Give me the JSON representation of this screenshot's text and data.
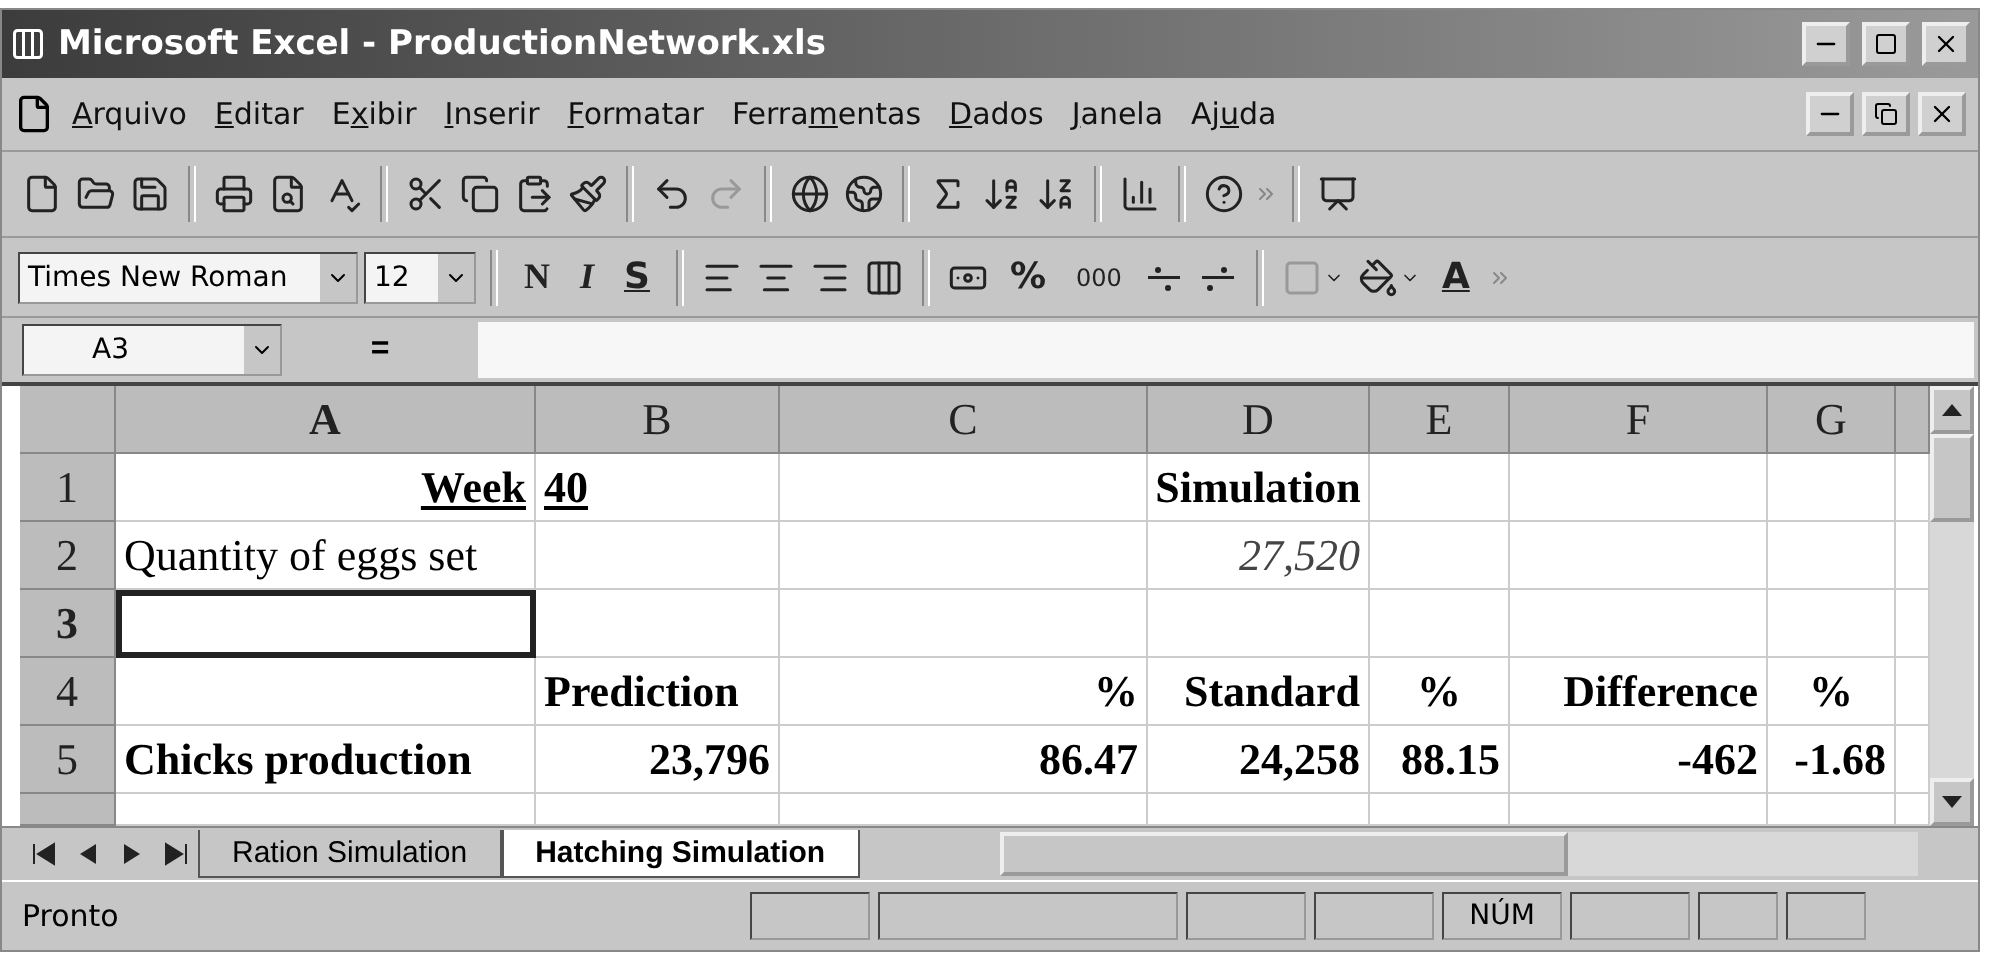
{
  "window": {
    "title": "Microsoft Excel - ProductionNetwork.xls"
  },
  "menu": [
    {
      "key": "A",
      "after": "rquivo"
    },
    {
      "key": "E",
      "after": "ditar"
    },
    {
      "before": "E",
      "key": "x",
      "after": "ibir"
    },
    {
      "key": "I",
      "after": "nserir"
    },
    {
      "key": "F",
      "after": "ormatar"
    },
    {
      "before": "Ferra",
      "key": "m",
      "after": "entas"
    },
    {
      "key": "D",
      "after": "ados"
    },
    {
      "key": "J",
      "after": "anela"
    },
    {
      "before": "Aj",
      "key": "u",
      "after": "da"
    }
  ],
  "standard_toolbar": {
    "redo_disabled": true
  },
  "format_toolbar": {
    "font": "Times New Roman",
    "size": "12",
    "bold": "N",
    "italic": "I",
    "underline": "S",
    "percent": "%",
    "thousands": "000",
    "font_color": "A"
  },
  "formula_bar": {
    "name_box": "A3",
    "equals": "="
  },
  "columns": [
    {
      "label": "A",
      "selected": true
    },
    {
      "label": "B",
      "selected": false
    },
    {
      "label": "C",
      "selected": false
    },
    {
      "label": "D",
      "selected": false
    },
    {
      "label": "E",
      "selected": false
    },
    {
      "label": "F",
      "selected": false
    },
    {
      "label": "G",
      "selected": false
    }
  ],
  "rows": [
    {
      "number": "1",
      "selected": false,
      "cells": [
        {
          "text": "Week",
          "right": true,
          "bold": true,
          "underline": true
        },
        {
          "text": "40",
          "bold": true,
          "underline": true
        },
        null,
        {
          "text": "Simulation",
          "center": true,
          "bold": true
        },
        null,
        null,
        null
      ]
    },
    {
      "number": "2",
      "selected": false,
      "cells": [
        {
          "text": "Quantity of eggs set"
        },
        null,
        null,
        {
          "text": "27,520",
          "right": true,
          "italic": true
        },
        null,
        null,
        null
      ]
    },
    {
      "number": "3",
      "selected": true,
      "cells": [
        null,
        null,
        null,
        null,
        null,
        null,
        null
      ]
    },
    {
      "number": "4",
      "selected": false,
      "cells": [
        null,
        {
          "text": "Prediction",
          "bold": true
        },
        {
          "text": "%",
          "right": true,
          "bold": true
        },
        {
          "text": "Standard",
          "right": true,
          "bold": true
        },
        {
          "text": "%",
          "center": true,
          "bold": true
        },
        {
          "text": "Difference",
          "right": true,
          "bold": true
        },
        {
          "text": "%",
          "center": true,
          "bold": true
        }
      ]
    },
    {
      "number": "5",
      "selected": false,
      "cells": [
        {
          "text": "Chicks production",
          "bold": true
        },
        {
          "text": "23,796",
          "right": true,
          "bold": true
        },
        {
          "text": "86.47",
          "right": true,
          "bold": true
        },
        {
          "text": "24,258",
          "right": true,
          "bold": true
        },
        {
          "text": "88.15",
          "right": true,
          "bold": true
        },
        {
          "text": "-462",
          "right": true,
          "bold": true
        },
        {
          "text": "-1.68",
          "right": true,
          "bold": true
        }
      ]
    }
  ],
  "sheet_tabs": [
    {
      "label": "Ration Simulation",
      "selected": false
    },
    {
      "label": "Hatching Simulation",
      "selected": true
    }
  ],
  "status_bar": {
    "text": "Pronto",
    "indicator": "NÚM"
  }
}
